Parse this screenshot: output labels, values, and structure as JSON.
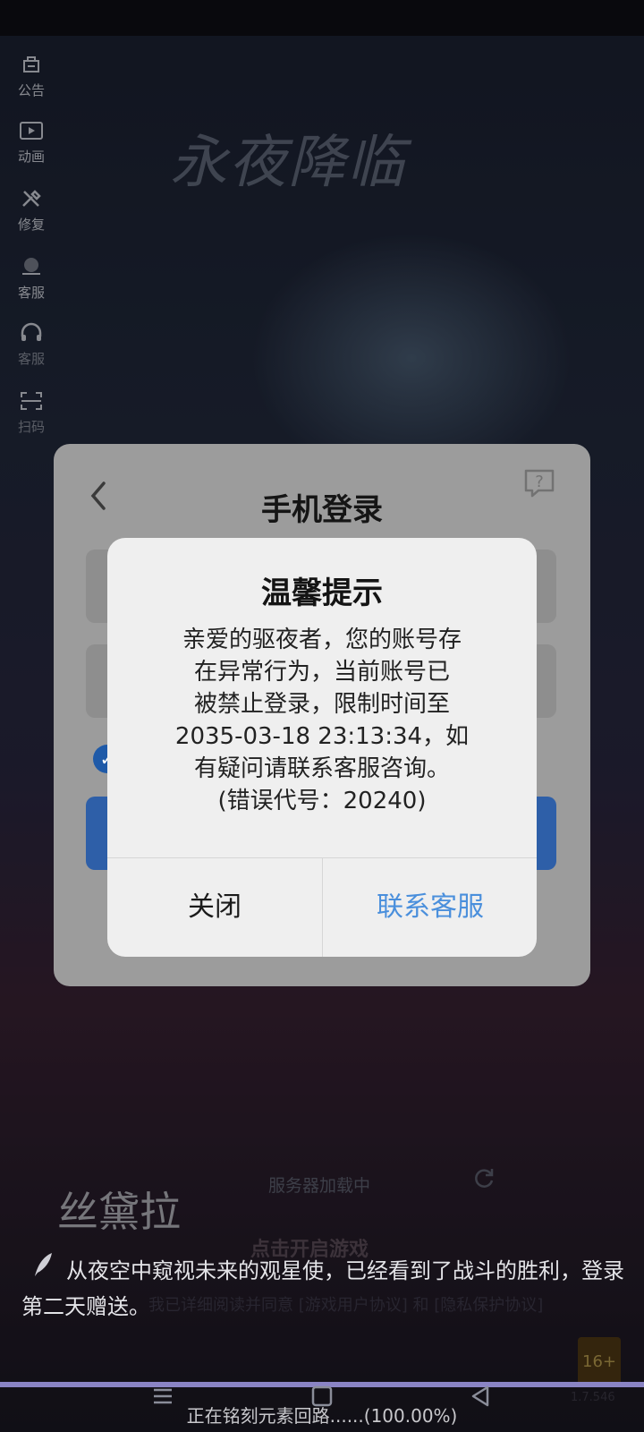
{
  "side_menu": [
    {
      "label": "公告",
      "icon": "announcement-icon"
    },
    {
      "label": "动画",
      "icon": "video-icon"
    },
    {
      "label": "修复",
      "icon": "repair-tools-icon"
    },
    {
      "label": "客服",
      "icon": "customer-service-icon"
    },
    {
      "label": "客服",
      "icon": "headset-icon"
    },
    {
      "label": "扫码",
      "icon": "scan-icon"
    }
  ],
  "background": {
    "game_title_art": "永夜降临"
  },
  "login": {
    "title": "手机登录",
    "back_icon": "back-chevron-icon",
    "help_icon": "help-question-icon"
  },
  "dialog": {
    "title": "温馨提示",
    "message": "亲爱的驱夜者，您的账号存\n在异常行为，当前账号已\n被禁止登录，限制时间至\n2035-03-18 23:13:34，如\n有疑问请联系客服咨询。\n(错误代号：20240)",
    "close_label": "关闭",
    "contact_label": "联系客服",
    "contact_color": "#4a8fdc"
  },
  "bottom": {
    "logo_text": "丝黛拉",
    "server_status": "服务器加载中",
    "tap_to_start": "点击开启游戏",
    "notice": "从夜空中窥视未来的观星使，已经看到了战斗的胜利，登录第二天赠送。",
    "agreement": "我已详细阅读并同意 [游戏用户协议] 和 [隐私保护协议]",
    "age_badge": "16+",
    "version": "1.7.546"
  },
  "progress": {
    "text": "正在铭刻元素回路......(100.00%)",
    "percent": 100
  },
  "nav": {
    "menu_icon": "menu-lines-icon",
    "home_icon": "home-square-icon",
    "back_icon": "back-triangle-icon"
  }
}
